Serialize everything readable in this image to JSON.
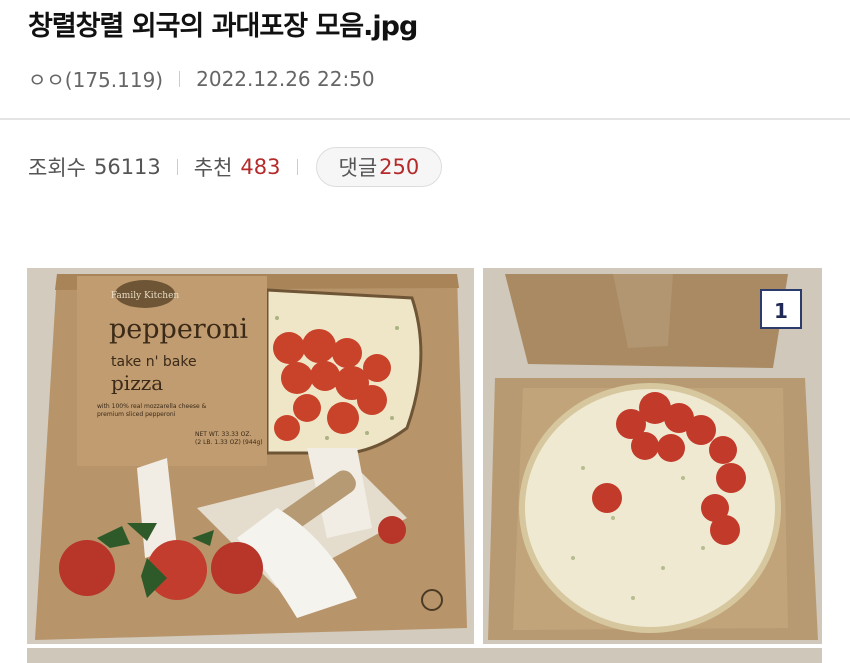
{
  "post": {
    "title": "창렬창렬 외국의 과대포장 모음.jpg",
    "author": "ㅇㅇ(175.119)",
    "datetime": "2022.12.26 22:50"
  },
  "stats": {
    "views_label": "조회수",
    "views": "56113",
    "recommend_label": "추천",
    "recommend": "483",
    "comments_label": "댓글",
    "comments": "250"
  },
  "gallery": {
    "badge": "1",
    "box_text": {
      "logo": "Family Kitchen",
      "product": "pepperoni",
      "subtitle": "take n' bake",
      "type": "pizza",
      "desc1": "with 100% real mozzarella cheese &",
      "desc2": "premium sliced pepperoni",
      "weight1": "NET WT. 33.33 OZ.",
      "weight2": "(2 LB. 1.33 OZ) (944g)"
    }
  },
  "colors": {
    "accent_red": "#b52a2a",
    "cardboard": "#b8946a",
    "badge_border": "#2b3b6b"
  }
}
